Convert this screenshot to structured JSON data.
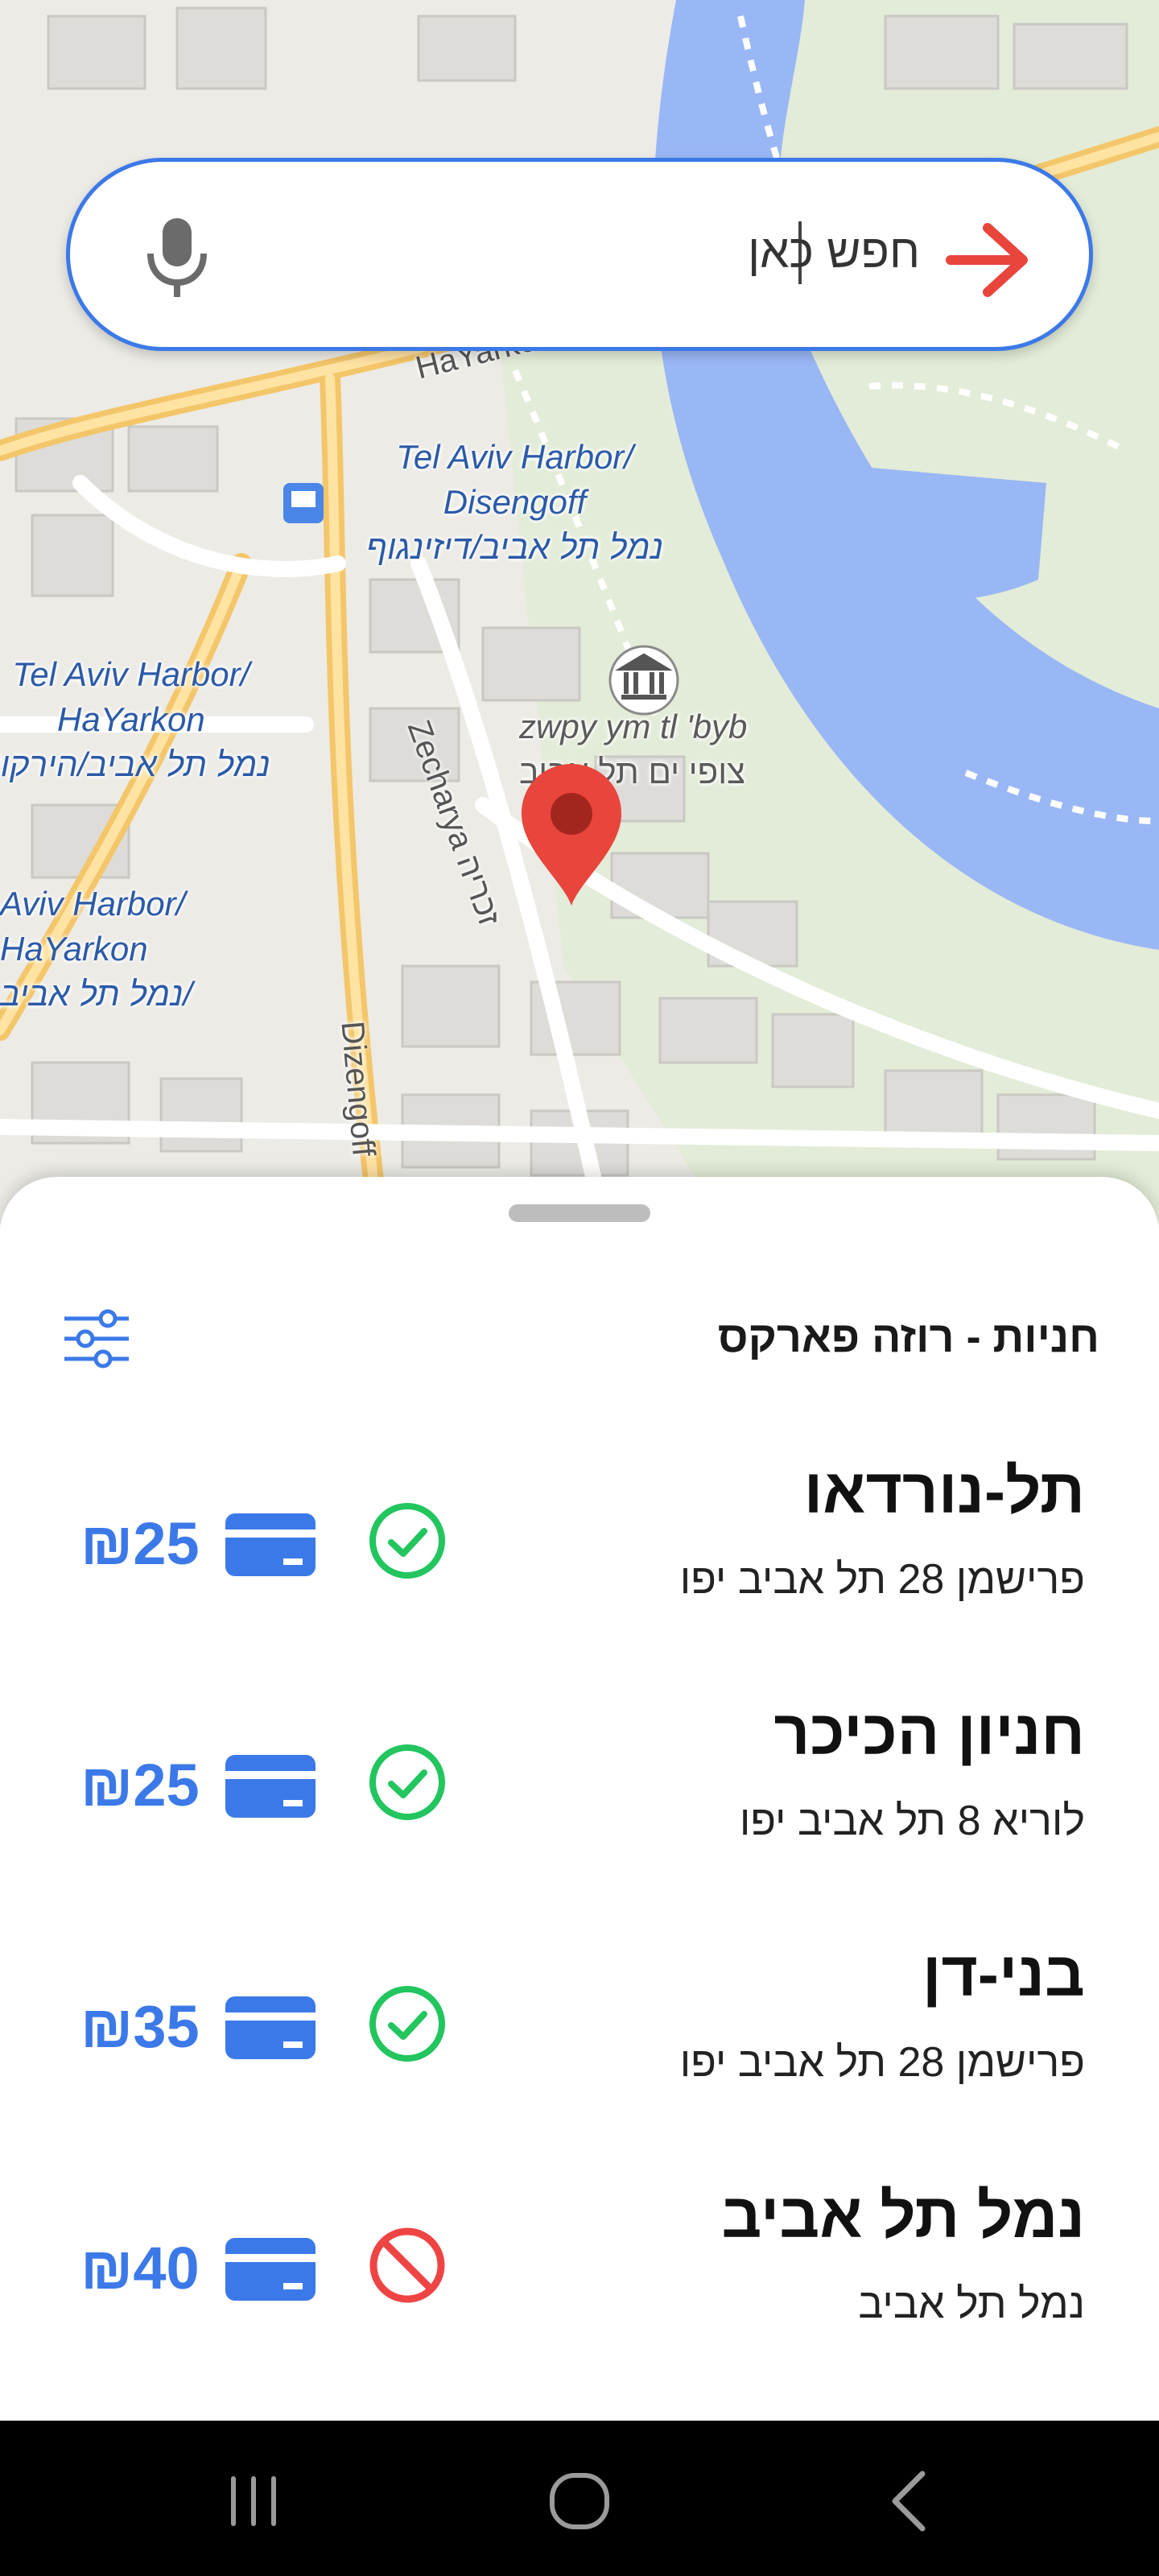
{
  "map": {
    "labels": {
      "harbor_disengoff_en": "Tel Aviv Harbor/\nDisengoff",
      "harbor_disengoff_he": "נמל תל אביב/דיזינגוף",
      "harbor_hayarkon_1_en": "Tel Aviv Harbor/\nHaYarkon",
      "harbor_hayarkon_1_he": "נמל תל אביב/הירקון",
      "harbor_hayarkon_2_en": "Aviv Harbor/\nHaYarkon",
      "harbor_hayarkon_2_he": "נמל תל אביב/",
      "museum_en": "zwpy ym tl 'byb",
      "museum_he": "צופי ים תל אביב",
      "street_zecharya": "Zecharya זכריה",
      "street_dizengoff": "Dizengoff",
      "street_hayarkon": "HaYarkon"
    }
  },
  "search": {
    "placeholder": "חפש כאן",
    "icons": {
      "voice": "mic-icon",
      "submit": "arrow-right-icon"
    }
  },
  "sheet": {
    "title": "חניות - רוזה פארקס",
    "filter_icon": "sliders-icon"
  },
  "lots": [
    {
      "name": "תל-נורדאו",
      "address": "פרישמן 28 תל אביב יפו",
      "status": "available",
      "price": "₪25"
    },
    {
      "name": "חניון הכיכר",
      "address": "לוריא 8 תל אביב יפו",
      "status": "available",
      "price": "₪25"
    },
    {
      "name": "בני-דן",
      "address": "פרישמן 28 תל אביב יפו",
      "status": "available",
      "price": "₪35"
    },
    {
      "name": "נמל תל אביב",
      "address": "נמל תל אביב",
      "status": "unavailable",
      "price": "₪40"
    }
  ],
  "nav": {
    "recents": "recents-icon",
    "home": "home-icon",
    "back": "back-icon"
  },
  "colors": {
    "accent": "#3c79e8",
    "available": "#22c55e",
    "unavailable": "#ef4444",
    "pin": "#e8453c",
    "water": "#9ab7f5",
    "park": "#dcead0",
    "road": "#f7d27e"
  }
}
